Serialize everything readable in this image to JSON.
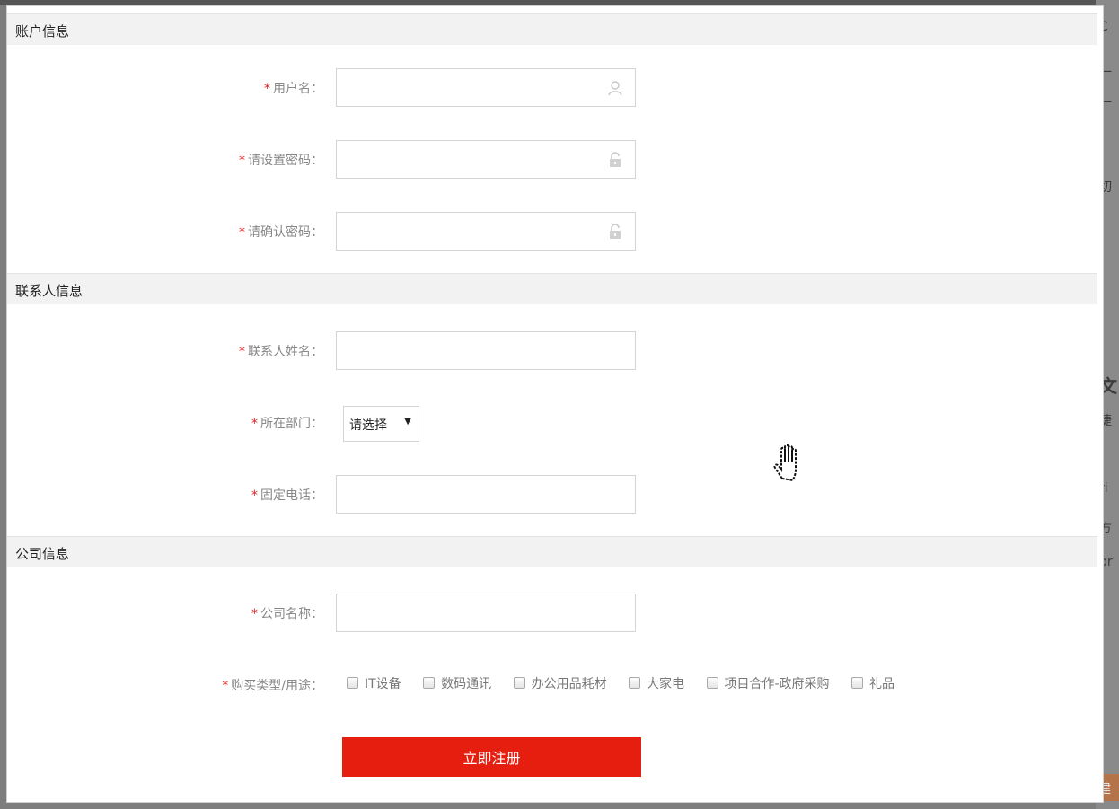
{
  "sections": {
    "account": {
      "title": "账户信息",
      "username_label": "用户名：",
      "password_label": "请设置密码：",
      "confirm_label": "请确认密码："
    },
    "contact": {
      "title": "联系人信息",
      "name_label": "联系人姓名：",
      "dept_label": "所在部门：",
      "dept_selected": "请选择",
      "phone_label": "固定电话："
    },
    "company": {
      "title": "公司信息",
      "company_label": "公司名称：",
      "purpose_label": "购买类型/用途：",
      "purpose_options": [
        "IT设备",
        "数码通讯",
        "办公用品耗材",
        "大家电",
        "项目合作-政府采购",
        "礼品"
      ]
    }
  },
  "required_mark": "*",
  "submit_label": "立即注册",
  "backdrop_fragments": [
    "C",
    "一",
    "一",
    "切",
    "文",
    "捷",
    "ri",
    "方",
    "br",
    "建"
  ],
  "colors": {
    "accent": "#e61e0f",
    "required": "#e02020",
    "section_bg": "#f2f2f2"
  }
}
